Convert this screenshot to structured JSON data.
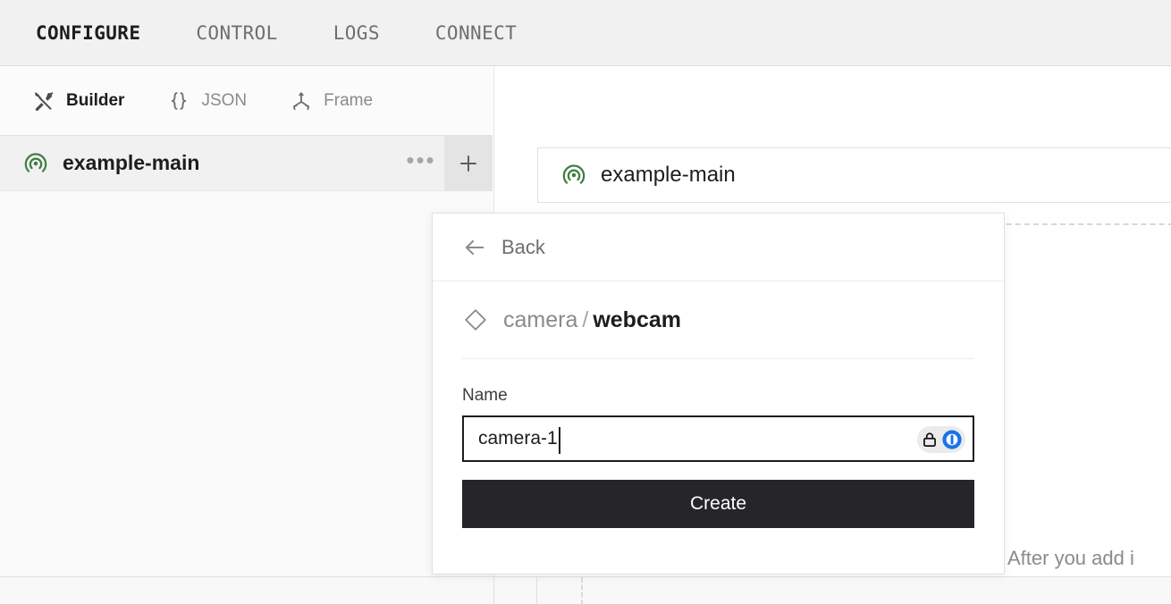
{
  "topnav": {
    "items": [
      {
        "label": "CONFIGURE",
        "active": true
      },
      {
        "label": "CONTROL",
        "active": false
      },
      {
        "label": "LOGS",
        "active": false
      },
      {
        "label": "CONNECT",
        "active": false
      }
    ]
  },
  "subbar": {
    "items": [
      {
        "label": "Builder",
        "icon": "tools-icon",
        "active": true
      },
      {
        "label": "JSON",
        "icon": "braces-icon",
        "active": false
      },
      {
        "label": "Frame",
        "icon": "axes-icon",
        "active": false
      }
    ]
  },
  "sidebar": {
    "row": {
      "label": "example-main",
      "icon": "signal-icon",
      "menu_icon": "ellipsis-icon",
      "add_icon": "plus-icon"
    }
  },
  "canvas": {
    "node": {
      "label": "example-main",
      "icon": "signal-icon"
    },
    "hint_text": "After you add i"
  },
  "popover": {
    "back_label": "Back",
    "back_icon": "arrow-left-icon",
    "breadcrumb": {
      "icon": "diamond-icon",
      "namespace": "camera",
      "separator": "/",
      "name": "webcam"
    },
    "name_field": {
      "label": "Name",
      "value": "camera-1",
      "placeholder": "Name"
    },
    "password_badge": {
      "lock_icon": "lock-icon",
      "onepassword_icon": "onepassword-icon"
    },
    "create_button": {
      "label": "Create"
    }
  },
  "colors": {
    "accent_green": "#3f7d3f",
    "nav_bg": "#f1f1f2",
    "button_dark": "#26262a",
    "badge_blue": "#1a73e8",
    "text_primary": "#1d1d1f",
    "text_muted": "#8a8a8f"
  }
}
